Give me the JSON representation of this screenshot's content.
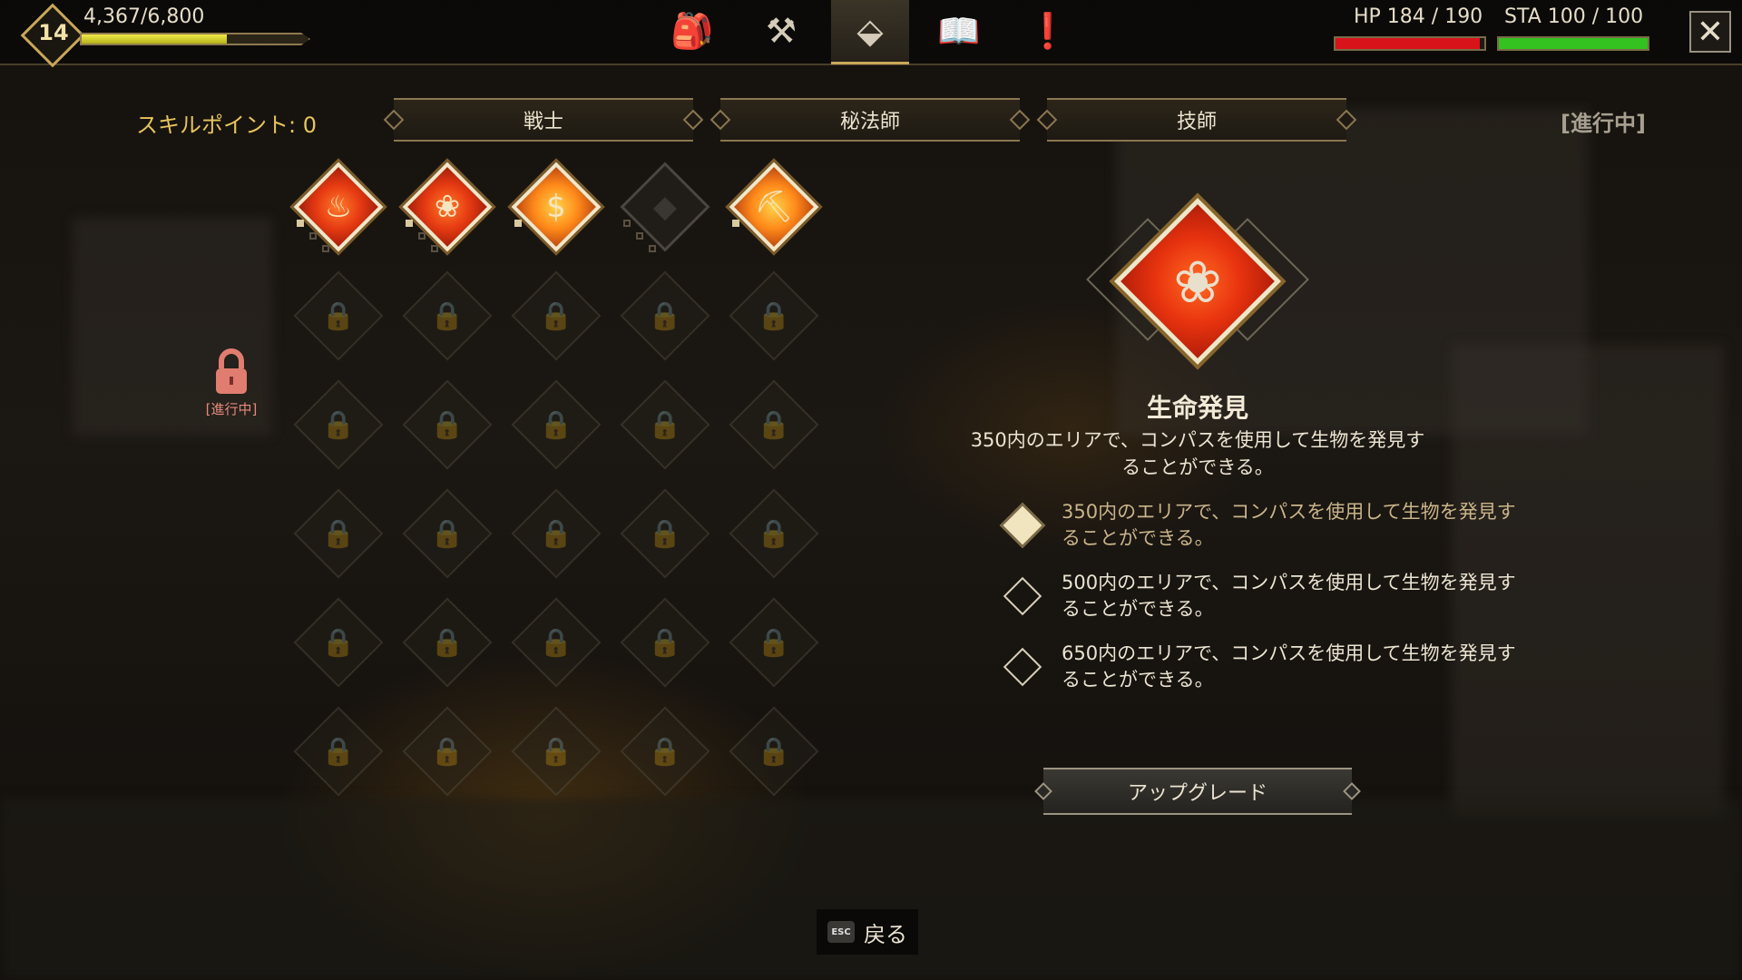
{
  "hud": {
    "level": "14",
    "xp_text": "4,367/6,800",
    "xp_fraction": 0.642,
    "hp_text": "HP 184 / 190",
    "hp_fraction": 0.968,
    "sta_text": "STA 100 / 100",
    "sta_fraction": 1.0,
    "hp_color": "#d8141a",
    "sta_color": "#33c21f",
    "close_label": "✕"
  },
  "nav": {
    "tabs": [
      {
        "name": "inventory",
        "icon": "backpack-icon",
        "glyph": "🎒",
        "active": false
      },
      {
        "name": "crafting",
        "icon": "hammer-icon",
        "glyph": "⚒",
        "active": false
      },
      {
        "name": "skills",
        "icon": "skill-tree-icon",
        "glyph": "⬙",
        "active": true
      },
      {
        "name": "journal",
        "icon": "book-icon",
        "glyph": "📖",
        "active": false
      },
      {
        "name": "quests",
        "icon": "alert-icon",
        "glyph": "❗",
        "active": false
      }
    ]
  },
  "skills_header": {
    "skill_points_label": "スキルポイント: 0",
    "class_tabs": [
      "戦士",
      "秘法師",
      "技師"
    ],
    "status": "[進行中]"
  },
  "tree": {
    "lock_label": "[進行中]",
    "row1": [
      {
        "name": "skill-fire-mask",
        "glyph": "♨",
        "variant": "red",
        "pips": [
          "on",
          "offp",
          "offp"
        ]
      },
      {
        "name": "skill-life-discovery",
        "glyph": "❀",
        "variant": "red",
        "pips": [
          "on",
          "offp",
          "offp"
        ]
      },
      {
        "name": "skill-money",
        "glyph": "$",
        "variant": "gold",
        "pips": [
          "on"
        ]
      },
      {
        "name": "skill-locked-dark",
        "glyph": "◆",
        "variant": "off",
        "pips": [
          "offp",
          "offp",
          "offp"
        ]
      },
      {
        "name": "skill-pickaxe",
        "glyph": "⛏",
        "variant": "gold",
        "pips": [
          "on"
        ]
      }
    ]
  },
  "detail": {
    "title": "生命発見",
    "description": "350内のエリアで、コンパスを使用して生物を発見することができる。",
    "tiers": [
      {
        "text": "350内のエリアで、コンパスを使用して生物を発見することができる。",
        "done": true
      },
      {
        "text": "500内のエリアで、コンパスを使用して生物を発見することができる。",
        "done": false
      },
      {
        "text": "650内のエリアで、コンパスを使用して生物を発見することができる。",
        "done": false
      }
    ],
    "upgrade_label": "アップグレード"
  },
  "footer": {
    "esc_key": "ESC",
    "back_label": "戻る"
  }
}
